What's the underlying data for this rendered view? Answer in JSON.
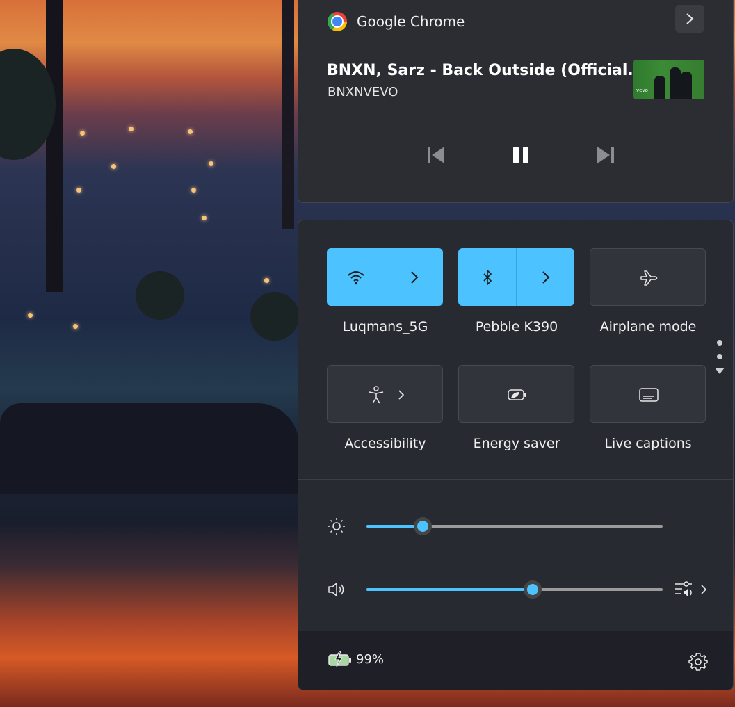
{
  "media": {
    "app_name": "Google Chrome",
    "title": "BNXN, Sarz - Back Outside (Official...",
    "artist": "BNXNVEVO",
    "thumbnail_text": "vevo",
    "controls": [
      "previous-icon",
      "pause-icon",
      "next-icon"
    ]
  },
  "quick_settings": {
    "tiles": [
      {
        "label": "Luqmans_5G",
        "icon": "wifi-icon",
        "active": true,
        "expandable": true
      },
      {
        "label": "Pebble K390",
        "icon": "bluetooth-icon",
        "active": true,
        "expandable": true
      },
      {
        "label": "Airplane mode",
        "icon": "airplane-icon",
        "active": false,
        "expandable": false
      },
      {
        "label": "Accessibility",
        "icon": "accessibility-icon",
        "active": false,
        "expandable": true
      },
      {
        "label": "Energy saver",
        "icon": "energy-saver-icon",
        "active": false,
        "expandable": false
      },
      {
        "label": "Live captions",
        "icon": "captions-icon",
        "active": false,
        "expandable": false
      }
    ],
    "brightness": {
      "icon": "brightness-icon",
      "level": 0.19
    },
    "volume": {
      "icon": "speaker-icon",
      "level": 0.56,
      "extra_icon": "sound-output-icon"
    },
    "battery": {
      "icon": "battery-charging-icon",
      "text": "99%"
    },
    "settings_icon": "gear-icon"
  },
  "colors": {
    "accent": "#4cc2ff",
    "panel": "#282a31",
    "tile_off": "#32343b"
  }
}
